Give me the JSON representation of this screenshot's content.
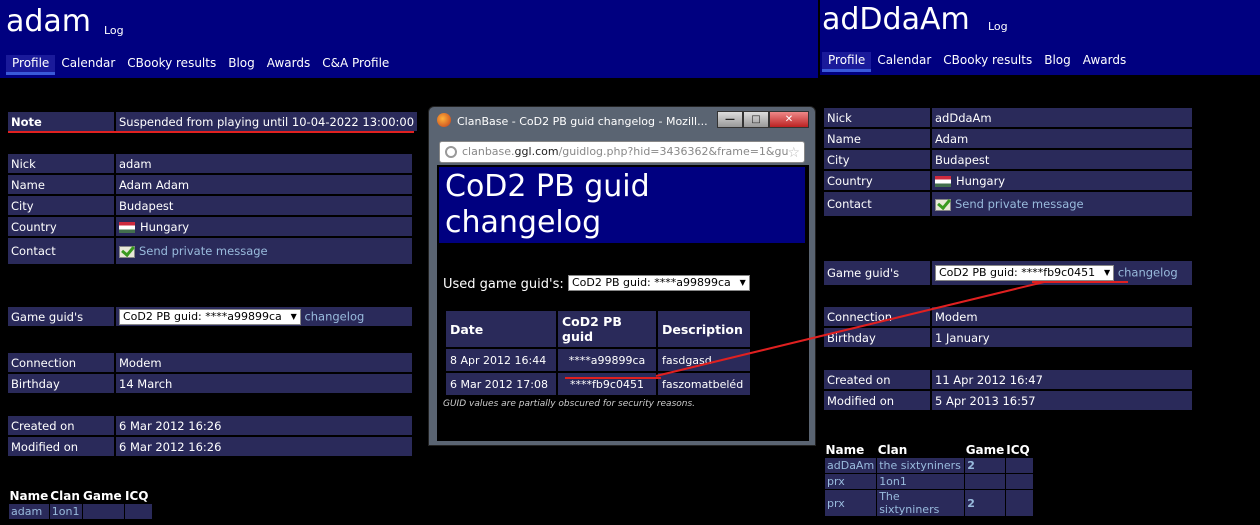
{
  "left": {
    "nick": "adam",
    "log_label": "Log",
    "tabs": [
      "Profile",
      "Calendar",
      "CBooky results",
      "Blog",
      "Awards",
      "C&A Profile"
    ],
    "note_label": "Note",
    "note_value": "Suspended from playing until 10-04-2022 13:00:00",
    "fields": [
      {
        "k": "Nick",
        "v": "adam"
      },
      {
        "k": "Name",
        "v": "Adam Adam"
      },
      {
        "k": "City",
        "v": "Budapest"
      },
      {
        "k": "Country",
        "v": "Hungary"
      },
      {
        "k": "Contact",
        "v": "Send private message"
      }
    ],
    "guid_label": "Game guid's",
    "guid_value": "CoD2 PB guid: ****a99899ca",
    "changelog": "changelog",
    "conn": [
      {
        "k": "Connection",
        "v": "Modem"
      },
      {
        "k": "Birthday",
        "v": "14 March"
      }
    ],
    "dates": [
      {
        "k": "Created on",
        "v": "6 Mar 2012 16:26"
      },
      {
        "k": "Modified on",
        "v": "6 Mar 2012 16:26"
      }
    ],
    "clan_headers": [
      "Name",
      "Clan",
      "Game",
      "ICQ"
    ],
    "clan_rows": [
      [
        "adam",
        "1on1",
        "",
        ""
      ]
    ]
  },
  "right": {
    "nick": "adDdaAm",
    "log_label": "Log",
    "tabs": [
      "Profile",
      "Calendar",
      "CBooky results",
      "Blog",
      "Awards"
    ],
    "fields": [
      {
        "k": "Nick",
        "v": "adDdaAm"
      },
      {
        "k": "Name",
        "v": "Adam"
      },
      {
        "k": "City",
        "v": "Budapest"
      },
      {
        "k": "Country",
        "v": "Hungary"
      },
      {
        "k": "Contact",
        "v": "Send private message"
      }
    ],
    "guid_label": "Game guid's",
    "guid_value": "CoD2 PB guid: ****fb9c0451",
    "changelog": "changelog",
    "conn": [
      {
        "k": "Connection",
        "v": "Modem"
      },
      {
        "k": "Birthday",
        "v": "1 January"
      }
    ],
    "dates": [
      {
        "k": "Created on",
        "v": "11 Apr 2012 16:47"
      },
      {
        "k": "Modified on",
        "v": "5 Apr 2013 16:57"
      }
    ],
    "clan_headers": [
      "Name",
      "Clan",
      "Game",
      "ICQ"
    ],
    "clan_rows": [
      [
        "adDaAm",
        "the sixtyniners",
        "2",
        ""
      ],
      [
        "prx",
        "1on1",
        "",
        ""
      ],
      [
        "prx",
        "The sixtyniners",
        "2",
        ""
      ]
    ]
  },
  "popup": {
    "title": "ClanBase - CoD2 PB guid changelog - Mozill...",
    "url_prefix": "clanbase.",
    "url_host": "ggl.com",
    "url_rest": "/guidlog.php?hid=3436362&frame=1&gu",
    "btn_min": "—",
    "btn_max": "□",
    "btn_close": "✕",
    "page_title": "CoD2 PB guid changelog",
    "used_label": "Used game guid's:",
    "used_value": "CoD2 PB guid: ****a99899ca",
    "headers": [
      "Date",
      "CoD2 PB guid",
      "Description"
    ],
    "rows": [
      [
        "8 Apr 2012 16:44",
        "****a99899ca",
        "fasdgasd"
      ],
      [
        "6 Mar 2012 17:08",
        "****fb9c0451",
        "faszomatbeléd"
      ]
    ],
    "disclaimer": "GUID values are partially obscured for security reasons."
  },
  "colors": {
    "header_bg": "#000080",
    "row_bg": "#2a2a5a",
    "accent_red": "#e02020",
    "link": "#99bbdd"
  }
}
